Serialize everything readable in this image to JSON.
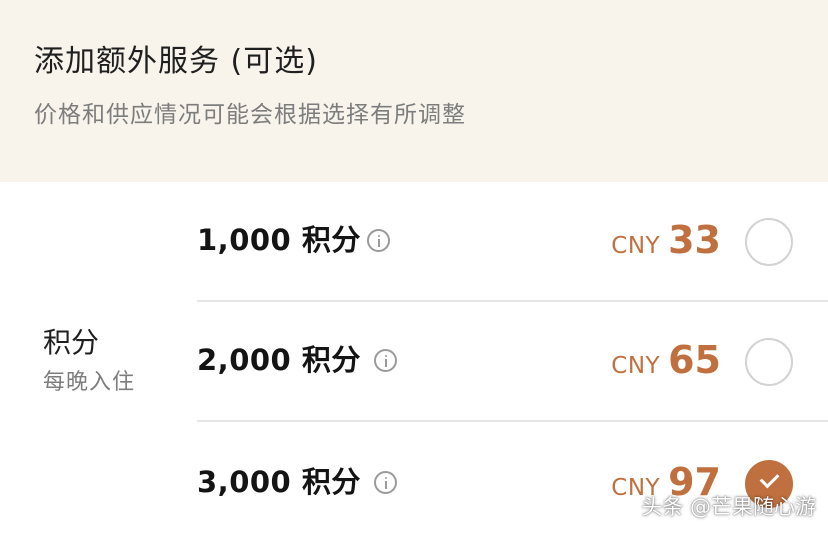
{
  "header": {
    "title": "添加额外服务 (可选)",
    "subtitle": "价格和供应情况可能会根据选择有所调整"
  },
  "category": {
    "title": "积分",
    "subtitle": "每晚入住"
  },
  "options": [
    {
      "label": "1,000 积分",
      "currency": "CNY",
      "amount": "33",
      "selected": false
    },
    {
      "label": "2,000 积分",
      "currency": "CNY",
      "amount": "65",
      "selected": false
    },
    {
      "label": "3,000 积分",
      "currency": "CNY",
      "amount": "97",
      "selected": true
    }
  ],
  "icons": {
    "info": "info-circle-icon",
    "radio_checked": "check-icon"
  },
  "colors": {
    "accent": "#c0703e",
    "header_bg": "#f8f4ec",
    "muted_text": "#7d7d7d"
  },
  "watermark": "头条 @芒果随心游"
}
